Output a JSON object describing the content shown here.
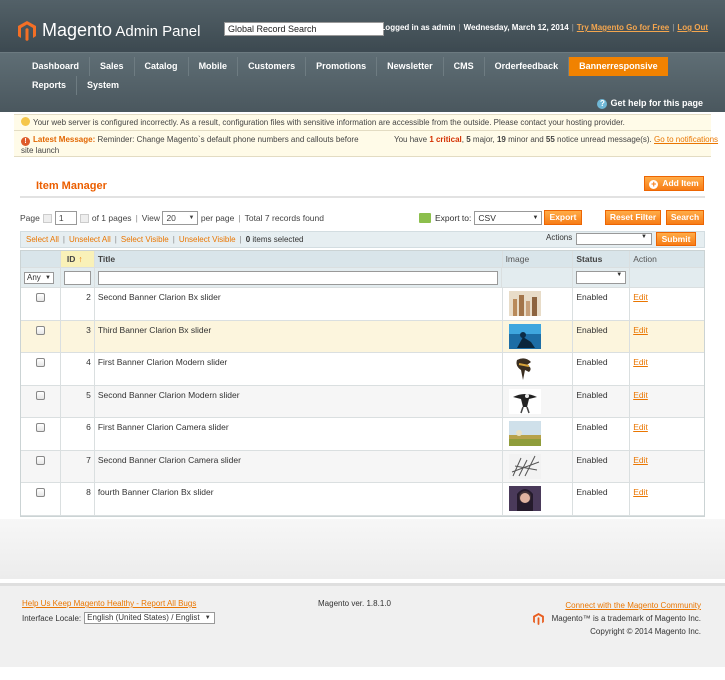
{
  "header": {
    "logo_text": "Magento",
    "logo_sub": "Admin Panel",
    "search_value": "Global Record Search",
    "logged_in": "Logged in as admin",
    "date": "Wednesday, March 12, 2014",
    "try_link": "Try Magento Go for Free",
    "logout_link": "Log Out"
  },
  "nav": {
    "items": [
      "Dashboard",
      "Sales",
      "Catalog",
      "Mobile",
      "Customers",
      "Promotions",
      "Newsletter",
      "CMS",
      "Orderfeedback",
      "Bannerresponsive",
      "Reports",
      "System"
    ],
    "active": "Bannerresponsive",
    "help": "Get help for this page"
  },
  "notices": {
    "config_warning": "Your web server is configured incorrectly. As a result, configuration files with sensitive information are accessible from the outside. Please contact your hosting provider.",
    "latest_label": "Latest Message:",
    "latest_text": "Reminder: Change Magento`s default phone numbers and callouts before site launch",
    "you_have": "You have",
    "critical": "1 critical",
    "major": "5",
    "major_label": "major,",
    "minor": "19",
    "minor_label": "minor and",
    "notice": "55",
    "notice_label": "notice unread message(s).",
    "go_link": "Go to notifications"
  },
  "page": {
    "title": "Item Manager",
    "add_button": "Add Item"
  },
  "pager": {
    "page_label": "Page",
    "page_value": "1",
    "of_pages": "of 1 pages",
    "view_label": "View",
    "view_value": "20",
    "per_page": "per page",
    "total": "Total 7 records found",
    "export_label": "Export to:",
    "export_value": "CSV",
    "export_button": "Export",
    "reset_button": "Reset Filter",
    "search_button": "Search"
  },
  "massaction": {
    "select_all": "Select All",
    "unselect_all": "Unselect All",
    "select_visible": "Select Visible",
    "unselect_visible": "Unselect Visible",
    "count": "0",
    "items_selected": "items selected",
    "actions_label": "Actions",
    "submit": "Submit"
  },
  "grid": {
    "columns": [
      "ID",
      "Title",
      "Image",
      "Status",
      "Action"
    ],
    "filter_any": "Any",
    "rows": [
      {
        "id": "2",
        "title": "Second Banner Clarion Bx slider",
        "status": "Enabled",
        "action": "Edit",
        "thumb": "city-skyline-thumb"
      },
      {
        "id": "3",
        "title": "Third Banner Clarion Bx slider",
        "status": "Enabled",
        "action": "Edit",
        "thumb": "blue-figure-thumb"
      },
      {
        "id": "4",
        "title": "First Banner Clarion Modern slider",
        "status": "Enabled",
        "action": "Edit",
        "thumb": "bird-thumb"
      },
      {
        "id": "5",
        "title": "Second Banner Clarion Modern slider",
        "status": "Enabled",
        "action": "Edit",
        "thumb": "eagle-thumb"
      },
      {
        "id": "6",
        "title": "First Banner Clarion Camera slider",
        "status": "Enabled",
        "action": "Edit",
        "thumb": "field-thumb"
      },
      {
        "id": "7",
        "title": "Second Banner Clarion Camera slider",
        "status": "Enabled",
        "action": "Edit",
        "thumb": "sketch-thumb"
      },
      {
        "id": "8",
        "title": "fourth Banner Clarion Bx slider",
        "status": "Enabled",
        "action": "Edit",
        "thumb": "portrait-thumb"
      }
    ]
  },
  "footer": {
    "bugs_link": "Help Us Keep Magento Healthy - Report All Bugs",
    "locale_label": "Interface Locale:",
    "locale_value": "English (United States) / Englist",
    "version": "Magento ver. 1.8.1.0",
    "community_link": "Connect with the Magento Community",
    "trademark": "Magento™ is a trademark of Magento Inc.",
    "copyright": "Copyright © 2014 Magento Inc."
  },
  "colors": {
    "accent": "#f18200",
    "header_bg": "#3d4a52",
    "link": "#ea7601"
  }
}
